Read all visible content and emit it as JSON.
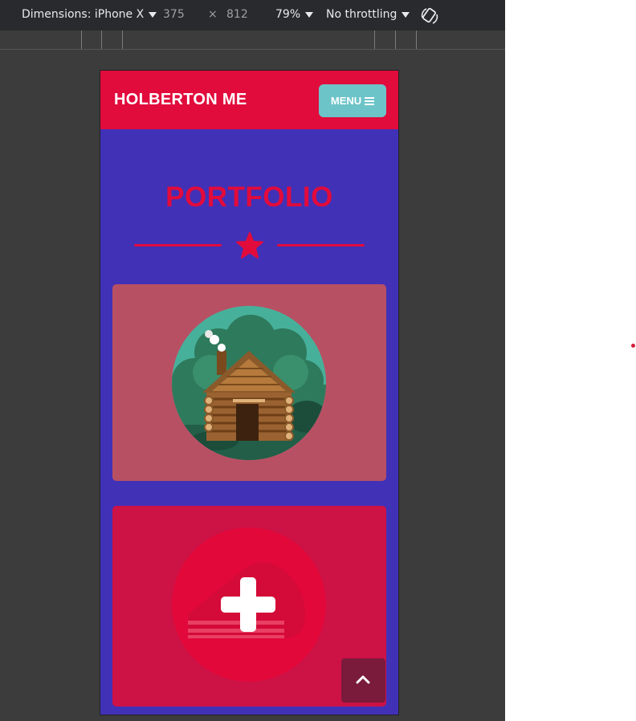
{
  "devtools": {
    "dimensions_label": "Dimensions: iPhone X",
    "width_value": "375",
    "times": "×",
    "height_value": "812",
    "zoom": "79%",
    "throttling": "No throttling",
    "rotate_icon": "rotate-icon"
  },
  "site": {
    "brand": "HOLBERTON ME",
    "menu_label": "MENU",
    "section_title": "PORTFOLIO",
    "cards": [
      {
        "image": "log-cabin-illustration"
      },
      {
        "image": "plus-illustration"
      }
    ],
    "scroll_top_icon": "chevron-up-icon"
  },
  "colors": {
    "accent_red": "#e10b3c",
    "purple_bg": "#4131b7",
    "menu_teal": "#6cc4c8",
    "card1_bg": "#b85064",
    "card2_bg": "#cd1246"
  }
}
